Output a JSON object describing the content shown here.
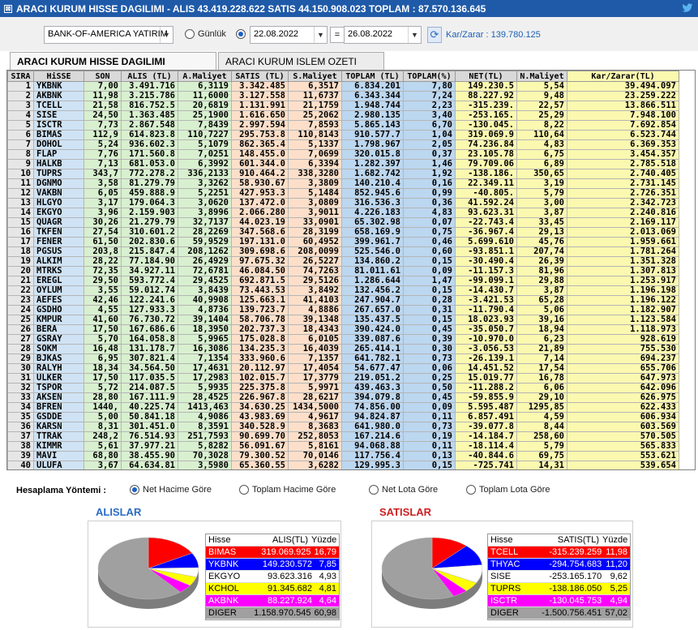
{
  "window": {
    "title": "ARACI KURUM HISSE DAGILIMI - ALIS 43.419.228.622  SATIS 44.150.908.023  TOPLAM : 87.570.136.645"
  },
  "controls": {
    "broker": "BANK-OF-AMERICA YATIRIM",
    "radio_daily": "Günlük",
    "date_from": "22.08.2022",
    "equals": "=",
    "date_to": "26.08.2022",
    "karzarar": "Kar/Zarar : 139.780.125"
  },
  "tabs": [
    "ARACI KURUM HISSE DAGILIMI",
    "ARACI KURUM ISLEM OZETI"
  ],
  "grid": {
    "headers": [
      "SIRA",
      "HiSSE",
      "SON",
      "ALIS (TL)",
      "A.Maliyet",
      "SATIS (TL)",
      "S.Maliyet",
      "TOPLAM (TL)",
      "TOPLAM(%)",
      "NET(TL)",
      "N.Maliyet",
      "Kar/Zarar(TL)"
    ],
    "rows": [
      [
        "1",
        "YKBNK",
        "7,00",
        "3.491.716",
        "6,3119",
        "3.342.485",
        "6,3517",
        "6.834.201",
        "7,80",
        "149.230.5",
        "5,54",
        "39.494.097"
      ],
      [
        "2",
        "AKBNK",
        "11,98",
        "3.215.786",
        "11,6000",
        "3.127.558",
        "11,6737",
        "6.343.344",
        "7,24",
        "88.227.92",
        "9,48",
        "23.259.222"
      ],
      [
        "3",
        "TCELL",
        "21,58",
        "816.752.5",
        "20,6819",
        "1.131.991",
        "21,1759",
        "1.948.744",
        "2,23",
        "-315.239.",
        "22,57",
        "13.866.511"
      ],
      [
        "4",
        "SISE",
        "24,50",
        "1.363.485",
        "25,1900",
        "1.616.650",
        "25,2062",
        "2.980.135",
        "3,40",
        "-253.165.",
        "25,29",
        "7.948.100"
      ],
      [
        "5",
        "ISCTR",
        "7,73",
        "2.867.548",
        "7,8439",
        "2.997.594",
        "7,8593",
        "5.865.143",
        "6,70",
        "-130.045.",
        "8,22",
        "7.692.854"
      ],
      [
        "6",
        "BIMAS",
        "112,9",
        "614.823.8",
        "110,7227",
        "295.753.8",
        "110,8143",
        "910.577.7",
        "1,04",
        "319.069.9",
        "110,64",
        "6.523.744"
      ],
      [
        "7",
        "DOHOL",
        "5,24",
        "936.602.3",
        "5,1079",
        "862.365.4",
        "5,1337",
        "1.798.967",
        "2,05",
        "74.236.84",
        "4,83",
        "6.369.353"
      ],
      [
        "8",
        "FLAP",
        "7,76",
        "171.560.8",
        "7,0251",
        "148.455.0",
        "7,0699",
        "320.015.8",
        "0,37",
        "23.105.78",
        "6,75",
        "3.454.357"
      ],
      [
        "9",
        "HALKB",
        "7,13",
        "681.053.0",
        "6,3992",
        "601.344.0",
        "6,3394",
        "1.282.397",
        "1,46",
        "79.709.06",
        "6,89",
        "2.785.518"
      ],
      [
        "10",
        "TUPRS",
        "343,7",
        "772.278.2",
        "336,2133",
        "910.464.2",
        "338,3280",
        "1.682.742",
        "1,92",
        "-138.186.",
        "350,65",
        "2.740.405"
      ],
      [
        "11",
        "DGNMO",
        "3,58",
        "81.279.79",
        "3,3262",
        "58.930.67",
        "3,3809",
        "140.210.4",
        "0,16",
        "22.349.11",
        "3,19",
        "2.731.145"
      ],
      [
        "12",
        "VAKBN",
        "6,05",
        "459.888.9",
        "5,2251",
        "427.953.3",
        "5,1484",
        "852.945.6",
        "0,99",
        "-40.805.",
        "5,79",
        "2.726.351"
      ],
      [
        "13",
        "HLGYO",
        "3,17",
        "179.064.3",
        "3,0620",
        "137.472.0",
        "3,0809",
        "316.536.3",
        "0,36",
        "41.592.24",
        "3,00",
        "2.342.723"
      ],
      [
        "14",
        "EKGYO",
        "3,96",
        "2.159.903",
        "3,8996",
        "2.066.280",
        "3,9011",
        "4.226.183",
        "4,83",
        "93.623.31",
        "3,87",
        "2.240.816"
      ],
      [
        "15",
        "QUAGR",
        "30,26",
        "21.279.79",
        "32,7137",
        "44.023.19",
        "33,0901",
        "65.302.98",
        "0,07",
        "-22.743.4",
        "33,45",
        "2.169.117"
      ],
      [
        "16",
        "TKFEN",
        "27,54",
        "310.601.2",
        "28,2269",
        "347.568.6",
        "28,3199",
        "658.169.9",
        "0,75",
        "-36.967.4",
        "29,13",
        "2.013.069"
      ],
      [
        "17",
        "FENER",
        "61,50",
        "202.830.6",
        "59,9529",
        "197.131.0",
        "60,4952",
        "399.961.7",
        "0,46",
        "5.699.610",
        "45,76",
        "1.959.661"
      ],
      [
        "18",
        "PGSUS",
        "203,8",
        "215.847.4",
        "208,1262",
        "309.698.6",
        "208,0099",
        "525.546.0",
        "0,60",
        "-93.851.1",
        "207,74",
        "1.781.264"
      ],
      [
        "19",
        "ALKIM",
        "28,22",
        "77.184.90",
        "26,4929",
        "97.675.32",
        "26,5227",
        "134.860.2",
        "0,15",
        "-30.490.4",
        "26,39",
        "1.351.328"
      ],
      [
        "20",
        "MTRKS",
        "72,35",
        "34.927.11",
        "72,6781",
        "46.084.50",
        "74,7263",
        "81.011.61",
        "0,09",
        "-11.157.3",
        "81,96",
        "1.307.813"
      ],
      [
        "21",
        "EREGL",
        "29,50",
        "593.772.4",
        "29,4525",
        "692.871.5",
        "29,5126",
        "1.286.644",
        "1,47",
        "-99.099.1",
        "29,88",
        "1.253.917"
      ],
      [
        "22",
        "OYLUM",
        "3,55",
        "59.012.74",
        "3,8439",
        "73.443.53",
        "3,8492",
        "132.456.2",
        "0,15",
        "-14.430.7",
        "3,87",
        "1.196.198"
      ],
      [
        "23",
        "AEFES",
        "42,46",
        "122.241.6",
        "40,9908",
        "125.663.1",
        "41,4103",
        "247.904.7",
        "0,28",
        "-3.421.53",
        "65,28",
        "1.196.122"
      ],
      [
        "24",
        "GSDHO",
        "4,55",
        "127.933.3",
        "4,8736",
        "139.723.7",
        "4,8886",
        "267.657.0",
        "0,31",
        "-11.790.4",
        "5,06",
        "1.182.907"
      ],
      [
        "25",
        "KMPUR",
        "41,60",
        "76.730.72",
        "39,1404",
        "58.706.78",
        "39,1348",
        "135.437.5",
        "0,15",
        "18.023.93",
        "39,16",
        "1.123.584"
      ],
      [
        "26",
        "BERA",
        "17,50",
        "167.686.6",
        "18,3950",
        "202.737.3",
        "18,4343",
        "390.424.0",
        "0,45",
        "-35.050.7",
        "18,94",
        "1.118.973"
      ],
      [
        "27",
        "GSRAY",
        "5,70",
        "164.058.8",
        "5,9965",
        "175.028.8",
        "6,0105",
        "339.087.6",
        "0,39",
        "-10.970.0",
        "6,23",
        "928.619"
      ],
      [
        "28",
        "SOKM",
        "16,48",
        "131.178.7",
        "16,3086",
        "134.235.3",
        "16,4039",
        "265.414.1",
        "0,30",
        "-3.056.53",
        "21,89",
        "755.530"
      ],
      [
        "29",
        "BJKAS",
        "6,95",
        "307.821.4",
        "7,1354",
        "333.960.6",
        "7,1357",
        "641.782.1",
        "0,73",
        "-26.139.1",
        "7,14",
        "694.237"
      ],
      [
        "30",
        "RALYH",
        "18,34",
        "34.564.50",
        "17,4631",
        "20.112.97",
        "17,4054",
        "54.677.47",
        "0,06",
        "14.451.52",
        "17,54",
        "655.706"
      ],
      [
        "31",
        "ULKER",
        "17,50",
        "117.035.5",
        "17,2983",
        "102.015.7",
        "17,3779",
        "219.051.2",
        "0,25",
        "15.019.77",
        "16,78",
        "647.973"
      ],
      [
        "32",
        "TSPOR",
        "5,72",
        "214.087.5",
        "5,9935",
        "225.375.8",
        "5,9971",
        "439.463.3",
        "0,50",
        "-11.288.2",
        "6,06",
        "642.096"
      ],
      [
        "33",
        "AKSEN",
        "28,80",
        "167.111.9",
        "28,4525",
        "226.967.8",
        "28,6217",
        "394.079.8",
        "0,45",
        "-59.855.9",
        "29,10",
        "626.975"
      ],
      [
        "34",
        "BFREN",
        "1440,",
        "40.225.74",
        "1413,463",
        "34.630.25",
        "1434,5000",
        "74.856.00",
        "0,09",
        "5.595.487",
        "1295,85",
        "622.433"
      ],
      [
        "35",
        "GSDDE",
        "5,00",
        "50.841.18",
        "4,9086",
        "43.983.69",
        "4,9617",
        "94.824.87",
        "0,11",
        "6.857.491",
        "4,59",
        "606.934"
      ],
      [
        "36",
        "KARSN",
        "8,31",
        "301.451.0",
        "8,3591",
        "340.528.9",
        "8,3683",
        "641.980.0",
        "0,73",
        "-39.077.8",
        "8,44",
        "603.569"
      ],
      [
        "37",
        "TTRAK",
        "248,2",
        "76.514.93",
        "251,7593",
        "90.699.70",
        "252,8053",
        "167.214.6",
        "0,19",
        "-14.184.7",
        "258,60",
        "570.505"
      ],
      [
        "38",
        "KIMMR",
        "5,61",
        "37.977.21",
        "5,8282",
        "56.091.67",
        "5,8161",
        "94.068.88",
        "0,11",
        "-18.114.4",
        "5,79",
        "565.833"
      ],
      [
        "39",
        "MAVI",
        "68,80",
        "38.455.90",
        "70,3028",
        "79.300.52",
        "70,0146",
        "117.756.4",
        "0,13",
        "-40.844.6",
        "69,75",
        "553.621"
      ],
      [
        "40",
        "ULUFA",
        "3,67",
        "64.634.81",
        "3,5980",
        "65.360.55",
        "3,6282",
        "129.995.3",
        "0,15",
        "-725.741",
        "14,31",
        "539.654"
      ]
    ]
  },
  "method": {
    "label": "Hesaplama Yöntemi :",
    "options": [
      {
        "label": "Net Hacime Göre",
        "selected": true
      },
      {
        "label": "Toplam Hacime Göre",
        "selected": false
      },
      {
        "label": "Net Lota Göre",
        "selected": false
      },
      {
        "label": "Toplam Lota Göre",
        "selected": false
      }
    ]
  },
  "alislar": {
    "title": "ALISLAR",
    "header": [
      "Hisse",
      "ALIS(TL)",
      "Yüzde"
    ],
    "rows": [
      {
        "name": "BIMAS",
        "value": "319.069.925",
        "pct": "16,79",
        "pctnum": 16.79,
        "color": "#ff0000",
        "fg": "#ffffff"
      },
      {
        "name": "YKBNK",
        "value": "149.230.572",
        "pct": "7,85",
        "pctnum": 7.85,
        "color": "#0000ff",
        "fg": "#ffffff"
      },
      {
        "name": "EKGYO",
        "value": "93.623.316",
        "pct": "4,93",
        "pctnum": 4.93,
        "color": "#ffffff",
        "fg": "#000000"
      },
      {
        "name": "KCHOL",
        "value": "91.345.682",
        "pct": "4,81",
        "pctnum": 4.81,
        "color": "#ffff00",
        "fg": "#000000"
      },
      {
        "name": "AKBNK",
        "value": "88.227.924",
        "pct": "4,64",
        "pctnum": 4.64,
        "color": "#ff00ff",
        "fg": "#ffffff"
      },
      {
        "name": "DIGER",
        "value": "1.158.970.545",
        "pct": "60,98",
        "pctnum": 60.98,
        "color": "#a0a0a0",
        "fg": "#000000"
      }
    ]
  },
  "satislar": {
    "title": "SATISLAR",
    "header": [
      "Hisse",
      "SATIS(TL)",
      "Yüzde"
    ],
    "rows": [
      {
        "name": "TCELL",
        "value": "-315.239.259",
        "pct": "11,98",
        "pctnum": 11.98,
        "color": "#ff0000",
        "fg": "#ffffff"
      },
      {
        "name": "THYAC",
        "value": "-294.754.683",
        "pct": "11,20",
        "pctnum": 11.2,
        "color": "#0000ff",
        "fg": "#ffffff"
      },
      {
        "name": "SISE",
        "value": "-253.165.170",
        "pct": "9,62",
        "pctnum": 9.62,
        "color": "#ffffff",
        "fg": "#000000"
      },
      {
        "name": "TUPRS",
        "value": "-138.186.050",
        "pct": "5,25",
        "pctnum": 5.25,
        "color": "#ffff00",
        "fg": "#000000"
      },
      {
        "name": "ISCTR",
        "value": "-130.045.753",
        "pct": "4,94",
        "pctnum": 4.94,
        "color": "#ff00ff",
        "fg": "#ffffff"
      },
      {
        "name": "DIGER",
        "value": "-1.500.756.451",
        "pct": "57,02",
        "pctnum": 57.02,
        "color": "#a0a0a0",
        "fg": "#000000"
      }
    ]
  }
}
